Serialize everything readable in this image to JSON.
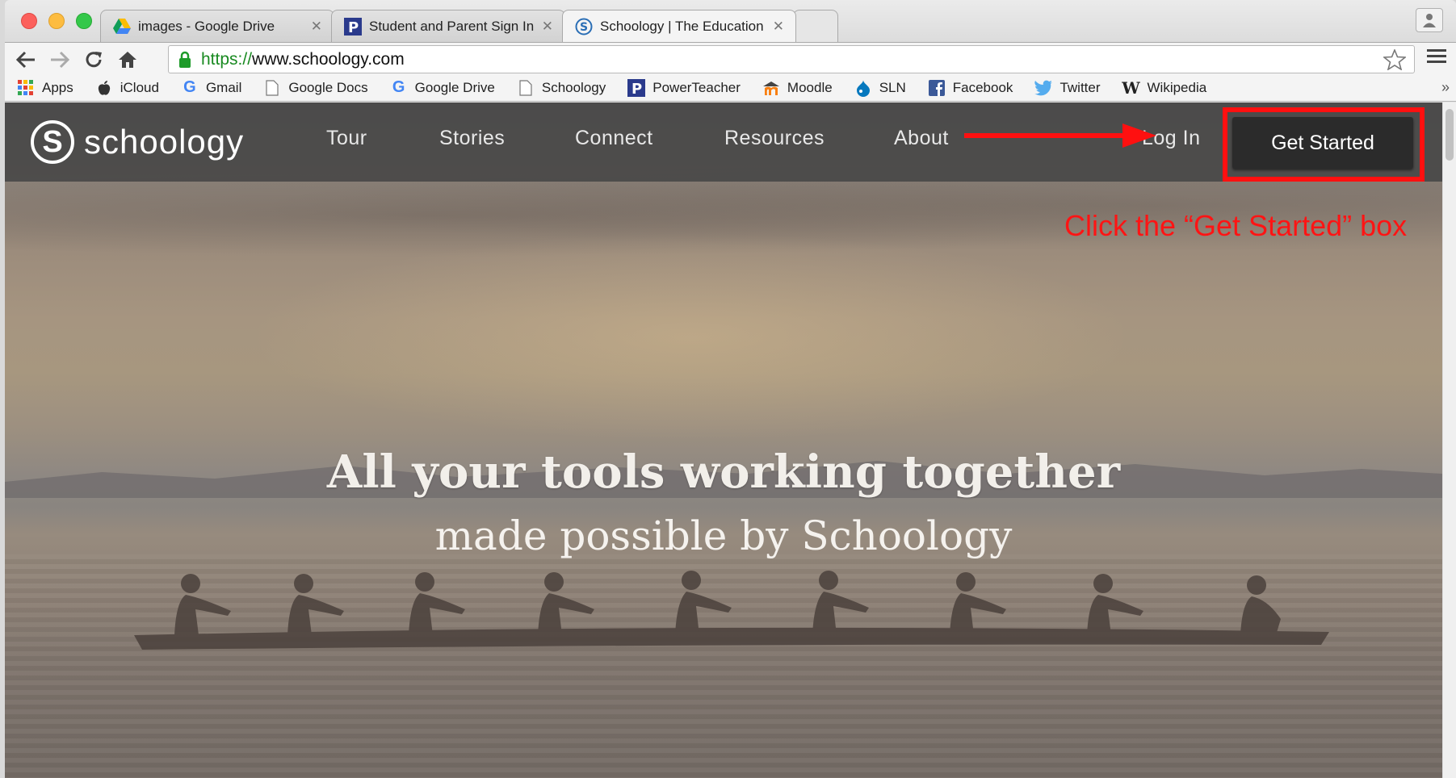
{
  "browser": {
    "tabs": [
      {
        "title": "images - Google Drive",
        "icon": "google-drive-icon"
      },
      {
        "title": "Student and Parent Sign In",
        "icon": "powerschool-icon"
      },
      {
        "title": "Schoology | The Education",
        "icon": "schoology-icon",
        "active": true
      }
    ],
    "address": {
      "scheme": "https://",
      "host": "www.schoology.com"
    },
    "bookmarks": [
      {
        "label": "Apps",
        "icon": "apps-grid-icon"
      },
      {
        "label": "iCloud",
        "icon": "apple-icon"
      },
      {
        "label": "Gmail",
        "icon": "google-icon"
      },
      {
        "label": "Google Docs",
        "icon": "page-icon"
      },
      {
        "label": "Google Drive",
        "icon": "google-icon"
      },
      {
        "label": "Schoology",
        "icon": "page-icon"
      },
      {
        "label": "PowerTeacher",
        "icon": "powerschool-icon"
      },
      {
        "label": "Moodle",
        "icon": "moodle-icon"
      },
      {
        "label": "SLN",
        "icon": "drupal-icon"
      },
      {
        "label": "Facebook",
        "icon": "facebook-icon"
      },
      {
        "label": "Twitter",
        "icon": "twitter-icon"
      },
      {
        "label": "Wikipedia",
        "icon": "wikipedia-icon"
      }
    ],
    "bookmarks_more": "»"
  },
  "site": {
    "logo_text": "schoology",
    "logo_mark": "S",
    "nav": {
      "tour": "Tour",
      "stories": "Stories",
      "connect": "Connect",
      "resources": "Resources",
      "about": "About",
      "login": "Log In",
      "get_started": "Get Started"
    },
    "hero": {
      "title": "All your tools working together",
      "subtitle": "made possible by Schoology"
    }
  },
  "annotation": {
    "text": "Click the “Get Started” box",
    "color": "#ff1414"
  },
  "colors": {
    "nav_bg": "#464646",
    "cta_bg": "#2b2b2b",
    "highlight": "#ff1010",
    "url_scheme": "#198a21"
  }
}
